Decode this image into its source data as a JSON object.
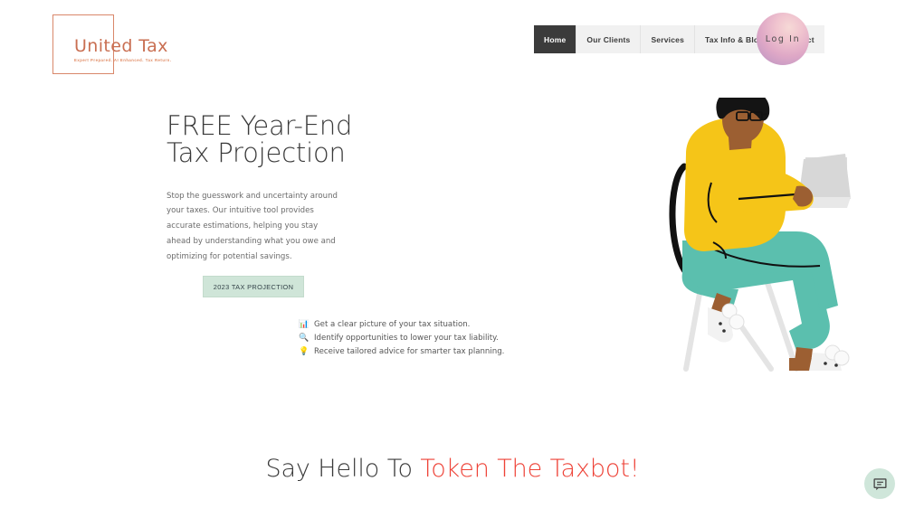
{
  "brand": {
    "name": "United Tax",
    "tagline": "Expert Prepared. AI Enhanced. Tax Return.",
    "frame_color": "#d9876a",
    "text_color": "#c96f52"
  },
  "nav": {
    "items": [
      {
        "label": "Home",
        "active": true
      },
      {
        "label": "Our Clients",
        "active": false
      },
      {
        "label": "Services",
        "active": false
      },
      {
        "label": "Tax Info & Blog",
        "active": false
      },
      {
        "label": "Contact",
        "active": false
      }
    ],
    "bg_color": "#f1f1f1",
    "active_bg_color": "#3b3b3b"
  },
  "login": {
    "label": "Log In",
    "gradient_from": "#f6d9d6",
    "gradient_to": "#b795c0"
  },
  "hero": {
    "title": "FREE Year-End\nTax Projection",
    "paragraph": "Stop the guesswork and uncertainty around your taxes. Our intuitive tool provides accurate estimations, helping you stay ahead by understanding what you owe and optimizing for potential savings.",
    "cta_label": "2023 TAX PROJECTION",
    "cta_bg_color": "#cfe5d8",
    "bullets": [
      {
        "icon": "bar-chart-emoji",
        "glyph": "📊",
        "text": "Get a clear picture of your tax situation."
      },
      {
        "icon": "magnifier-emoji",
        "glyph": "🔍",
        "text": "Identify opportunities to lower your tax liability."
      },
      {
        "icon": "lightbulb-emoji",
        "glyph": "💡",
        "text": "Receive tailored advice for smarter tax planning."
      }
    ]
  },
  "illustration": {
    "alt": "Person with glasses in yellow sweater and teal pants sitting on a chair using a laptop",
    "sweater_color": "#F5C518",
    "pants_color": "#5BBFAE",
    "skin_color": "#9C5F32",
    "hair_color": "#1A1A1A",
    "laptop_color": "#D8D8D8",
    "chair_color": "#E2E2E2",
    "shoe_color": "#EFEFEF"
  },
  "bottom_section": {
    "lead_text": "Say Hello To ",
    "accent_text": "Token The Taxbot!",
    "accent_color": "#ee4237"
  },
  "chat_widget": {
    "icon": "chat-message-icon",
    "bg_color": "#cfe6da"
  }
}
